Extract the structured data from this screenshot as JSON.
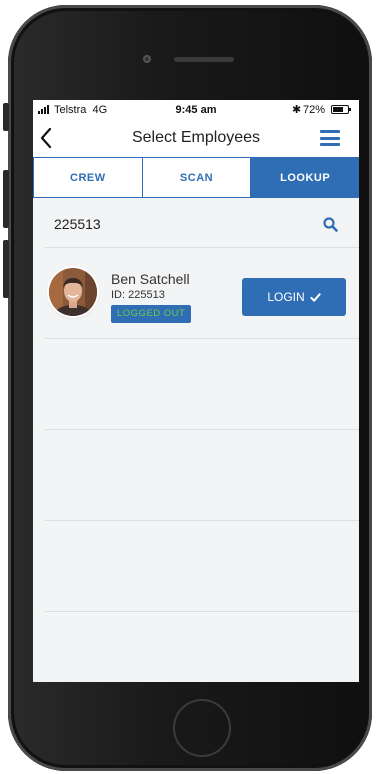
{
  "status_bar": {
    "carrier": "Telstra",
    "network": "4G",
    "time": "9:45 am",
    "battery_percent": "72%",
    "battery_level": 0.72,
    "icons": [
      "signal-icon",
      "bluetooth-icon",
      "battery-icon"
    ]
  },
  "nav": {
    "title": "Select Employees",
    "back_icon": "chevron-left-icon",
    "menu_icon": "hamburger-menu-icon"
  },
  "tabs": [
    {
      "label": "CREW",
      "active": false
    },
    {
      "label": "SCAN",
      "active": false
    },
    {
      "label": "LOOKUP",
      "active": true
    }
  ],
  "search": {
    "value": "225513",
    "icon": "search-icon"
  },
  "employees": [
    {
      "name": "Ben Satchell",
      "id_text": "ID: 225513",
      "status": "LOGGED OUT",
      "action_label": "LOGIN",
      "action_icon": "checkmark-icon"
    }
  ],
  "colors": {
    "accent": "#2f6eb5",
    "status_text": "#6ec84a",
    "background": "#f3f4f5"
  }
}
